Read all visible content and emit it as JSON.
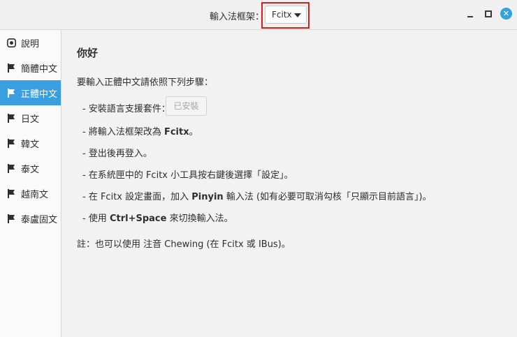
{
  "header": {
    "framework_label": "輸入法框架：",
    "framework_value": "Fcitx"
  },
  "sidebar": {
    "items": [
      {
        "label": "說明",
        "icon": "info-icon"
      },
      {
        "label": "簡體中文",
        "icon": "flag-icon"
      },
      {
        "label": "正體中文",
        "icon": "flag-icon"
      },
      {
        "label": "日文",
        "icon": "flag-icon"
      },
      {
        "label": "韓文",
        "icon": "flag-icon"
      },
      {
        "label": "泰文",
        "icon": "flag-icon"
      },
      {
        "label": "越南文",
        "icon": "flag-icon"
      },
      {
        "label": "泰盧固文",
        "icon": "flag-icon"
      }
    ],
    "active_index": 2
  },
  "main": {
    "heading": "你好",
    "intro": "要輸入正體中文請依照下列步驟：",
    "step1": "- 安裝語言支援套件：",
    "installed_button": "已安裝",
    "step2_pre": "- 將輸入法框架改為 ",
    "step2_bold": "Fcitx",
    "step2_post": "。",
    "step3": "- 登出後再登入。",
    "step4": "- 在系統匣中的 Fcitx 小工具按右鍵後選擇「設定」。",
    "step5_pre": "- 在 Fcitx 設定畫面，加入 ",
    "step5_bold": "Pinyin",
    "step5_post": " 輸入法 (如有必要可取消勾核「只顯示目前語言」)。",
    "step6_pre": "- 使用 ",
    "step6_bold": "Ctrl+Space",
    "step6_post": " 來切換輸入法。",
    "note": "註：也可以使用 注音 Chewing (在 Fcitx 或 IBus)。"
  },
  "colors": {
    "accent": "#3a9fe0",
    "highlight_box": "#d41f1f",
    "close_button": "#36a2dc"
  }
}
